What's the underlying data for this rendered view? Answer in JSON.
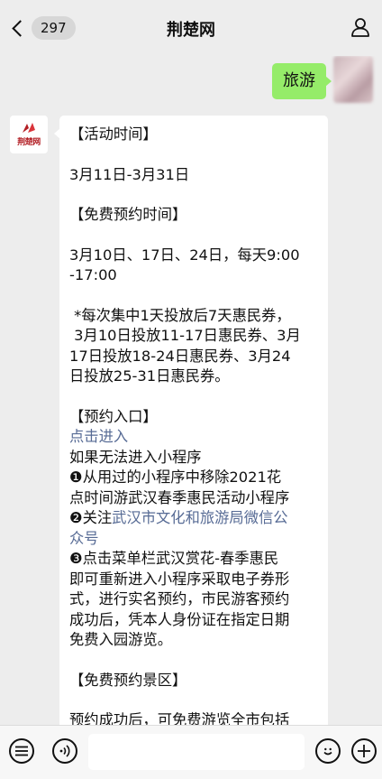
{
  "header": {
    "back_badge": "297",
    "title": "荆楚网"
  },
  "outgoing": {
    "text": "旅游"
  },
  "sender": {
    "logo_text": "荆楚网"
  },
  "message": {
    "h1": "【活动时间】",
    "dates": "3月11日-3月31日",
    "h2": "【免费预约时间】",
    "time_1": "3月10日、17日、24日，每天9:00",
    "time_2": "-17:00",
    "note_1": " *每次集中1天投放后7天惠民券，",
    "note_2": " 3月10日投放11-17日惠民券、3月",
    "note_3": "17日投放18-24日惠民券、3月24",
    "note_4": "日投放25-31日惠民券。",
    "h3": "【预约入口】",
    "link_enter": "点击进入",
    "if_fail": "如果无法进入小程序",
    "step1_a": "❶从用过的小程序中移除2021花",
    "step1_b": "点时间游武汉春季惠民活动小程序",
    "step2_prefix": "❷关注",
    "step2_link_a": "武汉市文化和旅游局微信公",
    "step2_link_b": "众号",
    "step3_a": "❸点击菜单栏武汉赏花-春季惠民",
    "step3_b": "即可重新进入小程序采取电子券形",
    "step3_c": "式，进行实名预约，市民游客预约",
    "step3_d": "成功后，凭本人身份证在指定日期",
    "step3_e": "免费入园游览。",
    "h4": "【免费预约景区】",
    "tail": "预约成功后，可免费游览全市包括"
  },
  "colors": {
    "outgoing_bubble": "#95ec69",
    "link": "#576b95",
    "logo_red": "#b21e24"
  },
  "icons": [
    "back-chevron-icon",
    "person-icon",
    "menu-list-icon",
    "voice-icon",
    "emoji-icon",
    "plus-icon"
  ]
}
